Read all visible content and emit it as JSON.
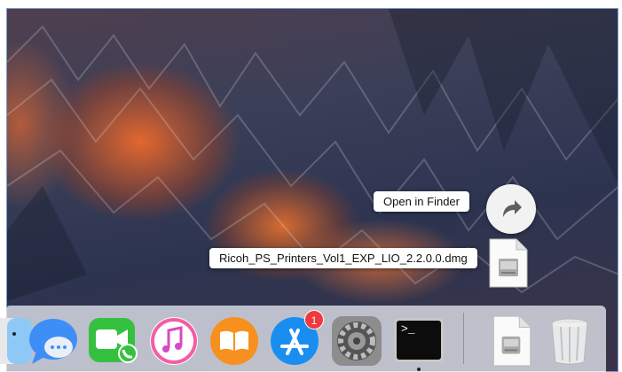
{
  "tooltips": {
    "open_in_finder": "Open in Finder",
    "file_name": "Ricoh_PS_Printers_Vol1_EXP_LIO_2.2.0.0.dmg"
  },
  "dock": {
    "items": [
      {
        "name": "Finder",
        "icon": "finder-icon"
      },
      {
        "name": "Messages",
        "icon": "messages-icon"
      },
      {
        "name": "FaceTime",
        "icon": "facetime-icon"
      },
      {
        "name": "iTunes",
        "icon": "itunes-icon"
      },
      {
        "name": "iBooks",
        "icon": "ibooks-icon"
      },
      {
        "name": "App Store",
        "icon": "app-store-icon"
      },
      {
        "name": "System Preferences",
        "icon": "system-preferences-icon"
      },
      {
        "name": "Terminal",
        "icon": "terminal-icon"
      },
      {
        "name": "Downloads",
        "icon": "dmg-file-icon"
      },
      {
        "name": "Trash",
        "icon": "trash-icon"
      }
    ],
    "app_store_badge": "1",
    "terminal_prompt": ">_"
  },
  "colors": {
    "badge": "#f0393d",
    "messages": "#3d8ff7",
    "facetime": "#36c03f",
    "itunes": "#f25ea6",
    "ibooks": "#f7901e",
    "app_store": "#1a8ef0"
  }
}
